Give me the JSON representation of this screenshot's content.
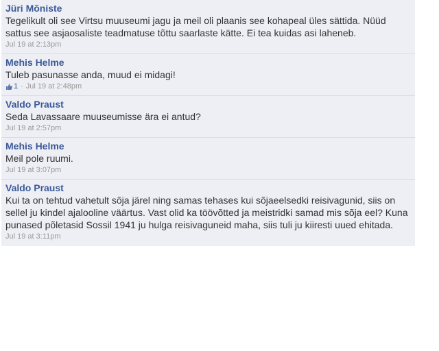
{
  "comments": [
    {
      "author": "Jüri Mõniste",
      "text": "Tegelikult oli see Virtsu muuseumi jagu ja meil oli plaanis see kohapeal üles sättida. Nüüd sattus see asjaosaliste teadmatuse tõttu saarlaste kätte. Ei tea kuidas asi laheneb.",
      "timestamp": "Jul 19 at 2:13pm"
    },
    {
      "author": "Mehis Helme",
      "text": "Tuleb pasunasse anda, muud ei midagi!",
      "likes": "1",
      "like_icon": "thumbs-up-icon",
      "separator": "·",
      "timestamp": "Jul 19 at 2:48pm"
    },
    {
      "author": "Valdo Praust",
      "text": "Seda Lavassaare muuseumisse ära ei antud?",
      "timestamp": "Jul 19 at 2:57pm"
    },
    {
      "author": "Mehis Helme",
      "text": "Meil pole ruumi.",
      "timestamp": "Jul 19 at 3:07pm"
    },
    {
      "author": "Valdo Praust",
      "text": "Kui ta on tehtud vahetult sõja järel ning samas tehases kui sõjaeelsedki reisivagunid, siis on sellel ju kindel ajalooline väärtus. Vast olid ka töövõtted ja meistridki samad mis sõja eel? Kuna punased põletasid Sossil 1941 ju hulga reisivaguneid maha, siis tuli ju kiiresti uued ehitada.",
      "timestamp": "Jul 19 at 3:11pm"
    }
  ],
  "colors": {
    "background": "#edeff4",
    "author": "#3b5998",
    "text": "#333333",
    "meta": "#999999",
    "divider": "#d8dce6"
  }
}
